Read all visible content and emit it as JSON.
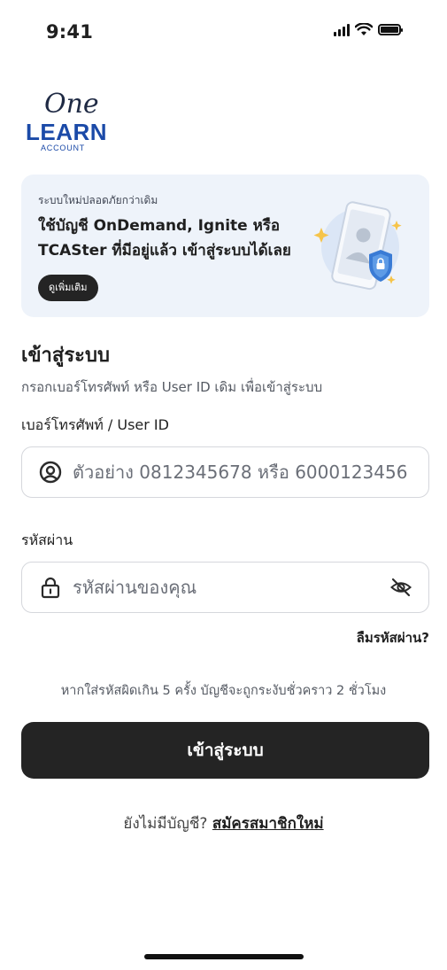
{
  "status_bar": {
    "time": "9:41"
  },
  "logo": {
    "script_text": "One",
    "main_text": "LEARN",
    "sub_text": "ACCOUNT"
  },
  "promo": {
    "kicker": "ระบบใหม่ปลอดภัยกว่าเดิม",
    "title": "ใช้บัญชี OnDemand, Ignite หรือ TCASter ที่มีอยู่แล้ว เข้าสู่ระบบได้เลย",
    "button_label": "ดูเพิ่มเติม"
  },
  "login": {
    "title": "เข้าสู่ระบบ",
    "subtitle": "กรอกเบอร์โทรศัพท์ หรือ User ID เดิม เพื่อเข้าสู่ระบบ",
    "username_label": "เบอร์โทรศัพท์ / User ID",
    "username_placeholder": "ตัวอย่าง 0812345678 หรือ 6000123456",
    "password_label": "รหัสผ่าน",
    "password_placeholder": "รหัสผ่านของคุณ",
    "forgot_label": "ลืมรหัสผ่าน?",
    "lockout_note": "หากใส่รหัสผิดเกิน 5 ครั้ง บัญชีจะถูกระงับชั่วคราว 2 ชั่วโมง",
    "submit_label": "เข้าสู่ระบบ",
    "signup_prompt": "ยังไม่มีบัญชี? ",
    "signup_link": "สมัครสมาชิกใหม่"
  },
  "icons": {
    "username": "user-circle-icon",
    "password": "lock-icon",
    "password_toggle": "eye-off-icon"
  },
  "colors": {
    "primary_button": "#242424",
    "promo_background": "#eef3fa",
    "logo_blue": "#1b4aa8"
  }
}
